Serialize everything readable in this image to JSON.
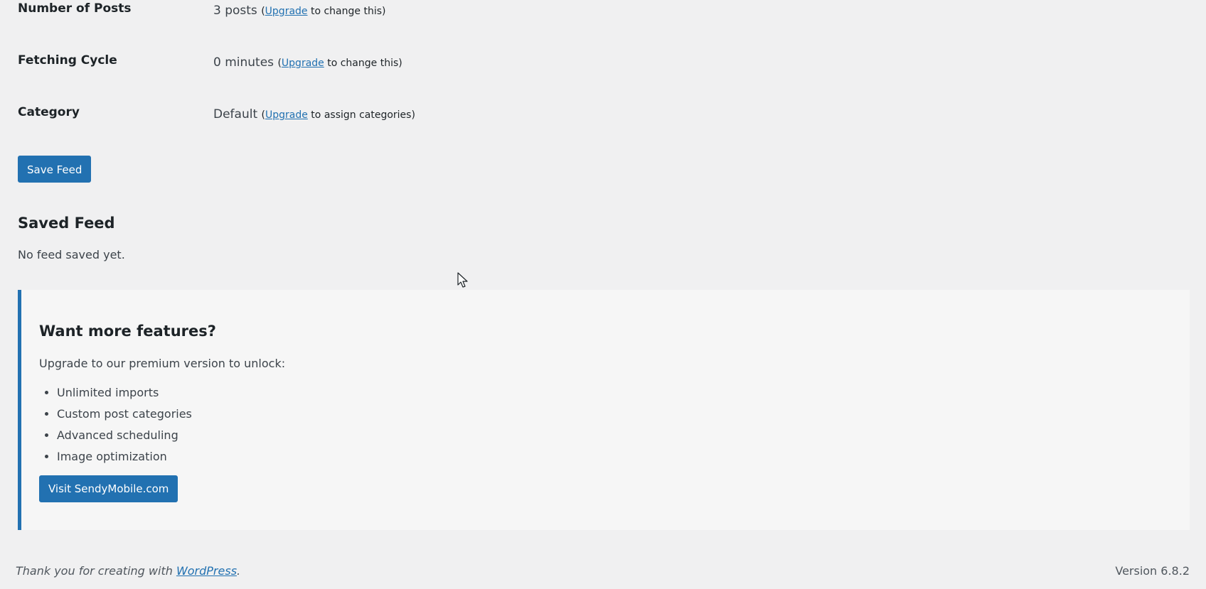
{
  "form": {
    "posts": {
      "label": "Number of Posts",
      "value": "3 posts",
      "note_prefix": "(",
      "link": "Upgrade",
      "note_suffix": " to change this)"
    },
    "cycle": {
      "label": "Fetching Cycle",
      "value": "0 minutes",
      "note_prefix": "(",
      "link": "Upgrade",
      "note_suffix": " to change this)"
    },
    "category": {
      "label": "Category",
      "value": "Default",
      "note_prefix": "(",
      "link": "Upgrade",
      "note_suffix": " to assign categories)"
    },
    "save_button": "Save Feed"
  },
  "saved_feed": {
    "title": "Saved Feed",
    "empty_text": "No feed saved yet."
  },
  "promo": {
    "title": "Want more features?",
    "intro": "Upgrade to our premium version to unlock:",
    "features": [
      "Unlimited imports",
      "Custom post categories",
      "Advanced scheduling",
      "Image optimization"
    ],
    "button": "Visit SendyMobile.com"
  },
  "footer": {
    "thanks_prefix": "Thank you for creating with ",
    "thanks_link": "WordPress",
    "thanks_suffix": ".",
    "version": "Version 6.8.2"
  },
  "colors": {
    "background": "#f0f0f1",
    "accent": "#2271b1",
    "promo_background": "#f6f6f6"
  },
  "icons": {
    "cursor": "mouse-pointer-icon"
  }
}
